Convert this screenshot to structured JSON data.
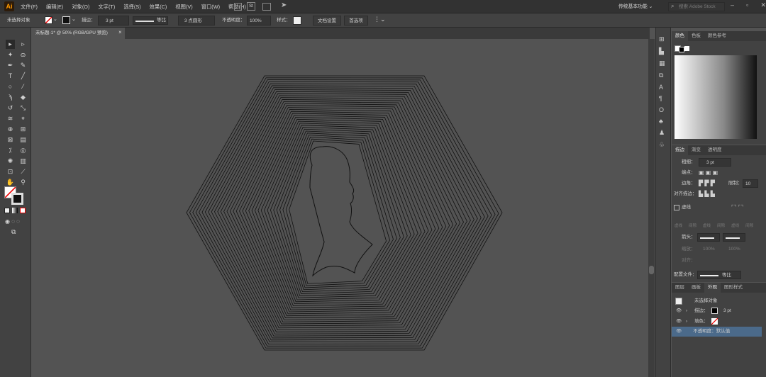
{
  "app": {
    "logo": "Ai"
  },
  "menu": [
    "文件(F)",
    "编辑(E)",
    "对象(O)",
    "文字(T)",
    "选择(S)",
    "效果(C)",
    "视图(V)",
    "窗口(W)",
    "帮助(H)"
  ],
  "top_right": {
    "workspace": "传统基本功能",
    "search_placeholder": "搜索 Adobe Stock"
  },
  "control": {
    "selection": "未选择对象",
    "stroke_label": "描边：",
    "stroke_value": "3 pt",
    "profile": "等比",
    "brush": "3 点圆形",
    "opacity_label": "不透明度：",
    "opacity_value": "100%",
    "style_label": "样式：",
    "doc_setup": "文档设置",
    "prefs": "首选项"
  },
  "document": {
    "tab_title": "未标题-1* @ 50% (RGB/GPU 预览)",
    "close": "×"
  },
  "color_panel": {
    "tabs": [
      "颜色",
      "色板",
      "颜色参考"
    ]
  },
  "stroke_panel": {
    "tabs": [
      "描边",
      "渐变",
      "透明度"
    ],
    "weight_label": "粗细：",
    "weight_value": "3 pt",
    "cap_label": "端点：",
    "corner_label": "边角：",
    "limit_label": "限制：",
    "limit_value": "10",
    "align_label": "对齐描边：",
    "dashed_label": "虚线",
    "dash_labels": [
      "虚线",
      "间隙",
      "虚线",
      "间隙",
      "虚线",
      "间隙"
    ],
    "arrow_label": "箭头：",
    "scale_label": "缩放：",
    "scale_values": [
      "100%",
      "100%"
    ],
    "align2_label": "对齐：",
    "profile_label": "配置文件：",
    "profile_value": "等比"
  },
  "appearance_panel": {
    "tabs": [
      "图层",
      "画板",
      "外观",
      "图形样式"
    ],
    "title": "未选择对象",
    "rows": [
      {
        "label": "描边：",
        "value": "3 pt"
      },
      {
        "label": "填色：",
        "value": ""
      },
      {
        "label": "不透明度：",
        "value": "默认值"
      }
    ]
  },
  "colors": {
    "accent": "#ff9a00",
    "selection": "#4b6a8a",
    "canvas": "#535353"
  }
}
